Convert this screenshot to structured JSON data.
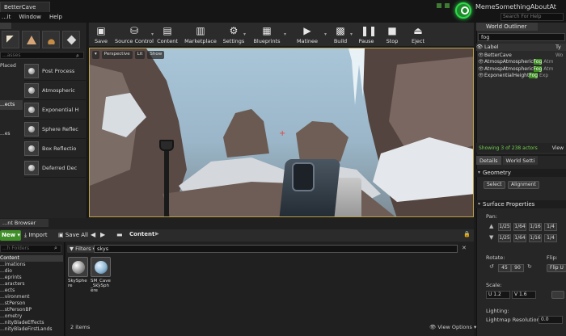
{
  "window": {
    "tab_title": "BetterCave",
    "menu": [
      "...it",
      "Window",
      "Help"
    ],
    "user_label": "MemeSomethingAboutAt",
    "help_search_placeholder": "Search For Help"
  },
  "modes": {
    "category_header": "...asses",
    "categories": [
      "Placed",
      "",
      "...ects",
      "",
      "...es",
      "",
      ""
    ],
    "placeables": [
      "Post Process",
      "Atmospheric",
      "Exponential H",
      "Sphere Reflec",
      "Box Reflectio",
      "Deferred Dec"
    ]
  },
  "toolbar": {
    "buttons": [
      {
        "label": "Save",
        "icon": "save-icon"
      },
      {
        "label": "Source Control",
        "icon": "source-control-icon"
      },
      {
        "label": "Content",
        "icon": "content-icon"
      },
      {
        "label": "Marketplace",
        "icon": "marketplace-icon"
      },
      {
        "label": "Settings",
        "icon": "settings-icon"
      },
      {
        "label": "Blueprints",
        "icon": "blueprints-icon"
      },
      {
        "label": "Matinee",
        "icon": "matinee-icon"
      },
      {
        "label": "Build",
        "icon": "build-icon"
      },
      {
        "label": "Pause",
        "icon": "pause-icon"
      },
      {
        "label": "Stop",
        "icon": "stop-icon"
      },
      {
        "label": "Eject",
        "icon": "eject-icon"
      }
    ]
  },
  "outliner": {
    "tab": "World Outliner",
    "search_value": "fog",
    "col_label": "Label",
    "col_type": "Ty",
    "rows": [
      {
        "name": "BetterCave",
        "type": "Wo"
      },
      {
        "name": "AtmospAtmospheric",
        "match": "Fog",
        "type": "Atm"
      },
      {
        "name": "AtmospAtmospheric",
        "match": "Fog",
        "type": "Atm"
      },
      {
        "name": "ExponentialHeight",
        "match": "Fog",
        "type": "Exp"
      }
    ],
    "count": "Showing 3 of 238 actors",
    "view": "View"
  },
  "details": {
    "tabs": [
      "Details",
      "World Setti"
    ],
    "geometry_header": "Geometry",
    "select_btn": "Select",
    "alignment_btn": "Alignment",
    "surface_header": "Surface Properties",
    "pan_label": "Pan:",
    "pan_row1": [
      "1/25",
      "1/64",
      "1/16",
      "1/4"
    ],
    "pan_row2": [
      "1/25",
      "1/64",
      "1/16",
      "1/4"
    ],
    "rotate_label": "Rotate:",
    "rotate_values": [
      "45",
      "90"
    ],
    "flip_label": "Flip:",
    "flip_btn": "Flip U",
    "scale_label": "Scale:",
    "scale_u": "U  1.2",
    "scale_v": "V  1.6",
    "lighting_label": "Lighting:",
    "lightmap_label": "Lightmap Resolution:",
    "lightmap_value": "0.0"
  },
  "content_browser": {
    "tab": "...nt Browser",
    "new_btn": "New",
    "import_btn": "Import",
    "saveall_btn": "Save All",
    "path": "Content",
    "folder_search_placeholder": "...h Folders",
    "folders": [
      "Content",
      "...imations",
      "...dio",
      "...eprints",
      "...aracters",
      "...ects",
      "...vironment",
      "...stPerson",
      "...stPersonBP",
      "...ometry",
      "...nityBladeEffects",
      "...nityBladeFirstLands"
    ],
    "filters_label": "Filters",
    "search_value": "skys",
    "assets": [
      {
        "label": "SkySphere"
      },
      {
        "label": "SM_Cave_SkySphere"
      }
    ],
    "item_count": "2 items",
    "view_options": "View Options"
  },
  "viewport": {
    "toolbar": [
      "▾",
      "Perspective",
      "Lit",
      "Show"
    ]
  },
  "colors": {
    "highlight_green": "#3b8f1e",
    "accent_green": "#2fd94a",
    "viewport_border": "#bba24a"
  }
}
